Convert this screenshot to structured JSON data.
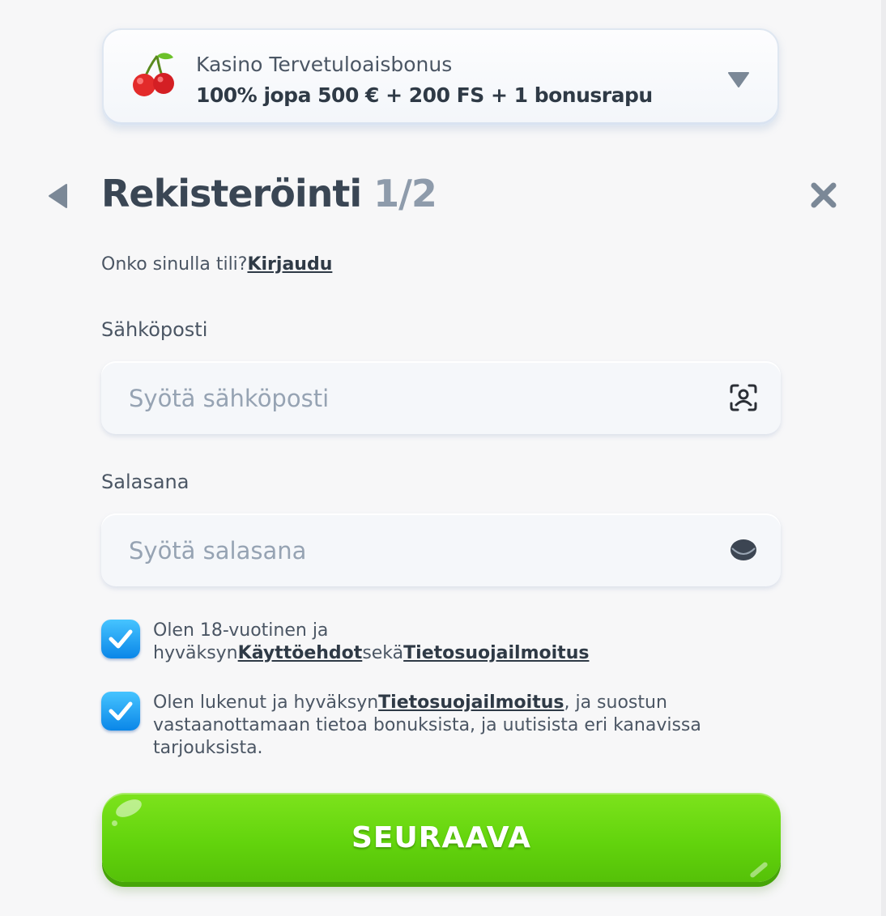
{
  "bonus": {
    "title": "Kasino Tervetuloaisbonus",
    "offer": "100% jopa 500 € + 200 FS + 1 bonusrapu",
    "icon": "cherry-icon"
  },
  "header": {
    "title": "Rekisteröinti",
    "step": "1/2"
  },
  "login_prompt": {
    "text": "Onko sinulla tili?",
    "link": "Kirjaudu"
  },
  "email": {
    "label": "Sähköposti",
    "placeholder": "Syötä sähköposti",
    "value": ""
  },
  "password": {
    "label": "Salasana",
    "placeholder": "Syötä salasana",
    "value": ""
  },
  "consents": [
    {
      "checked": true,
      "text_before": "Olen 18-vuotinen ja hyväksyn",
      "link1": "Käyttöehdot",
      "text_middle": "sekä",
      "link2": "Tietosuojailmoitus"
    },
    {
      "checked": true,
      "text_before": "Olen lukenut ja hyväksyn",
      "link1": "Tietosuojailmoitus",
      "text_after": ", ja suostun vastaanottamaan tietoa bonuksista, ja uutisista eri kanavissa tarjouksista."
    }
  ],
  "next_button": {
    "label": "SEURAAVA"
  },
  "colors": {
    "primary_green": "#63d40d",
    "checkbox_blue": "#1a9cf2",
    "text_dark": "#3a4654",
    "text_muted": "#8e9bab"
  }
}
